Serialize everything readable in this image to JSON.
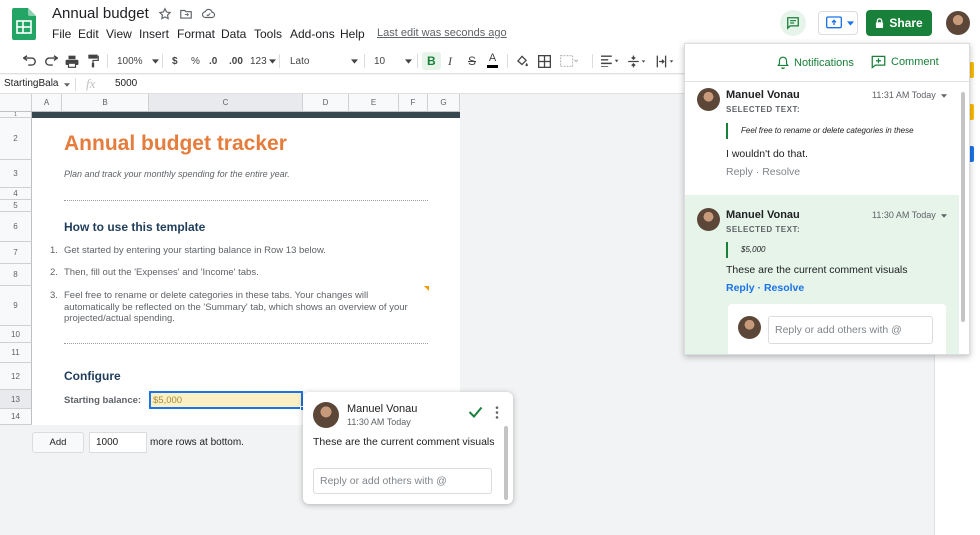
{
  "doc": {
    "title": "Annual budget",
    "last_edit": "Last edit was seconds ago"
  },
  "menu": [
    "File",
    "Edit",
    "View",
    "Insert",
    "Format",
    "Data",
    "Tools",
    "Add-ons",
    "Help"
  ],
  "share": {
    "label": "Share"
  },
  "toolbar": {
    "zoom": "100%",
    "currency": "$",
    "percent": "%",
    "dec_decrease": ".0",
    "dec_increase": ".00",
    "more_formats": "123",
    "font": "Lato",
    "font_size": "10"
  },
  "formula": {
    "name_box": "StartingBala",
    "fx": "fx",
    "value": "5000"
  },
  "columns": [
    "A",
    "B",
    "C",
    "D",
    "E",
    "F",
    "G"
  ],
  "rows": [
    "1",
    "2",
    "3",
    "4",
    "5",
    "6",
    "7",
    "8",
    "9",
    "10",
    "11",
    "12",
    "13",
    "14"
  ],
  "sheet": {
    "title": "Annual budget tracker",
    "subtitle": "Plan and track your monthly spending for the entire year.",
    "howto_heading": "How to use this template",
    "steps": [
      {
        "num": "1.",
        "text": "Get started by entering your starting balance in Row 13 below."
      },
      {
        "num": "2.",
        "text": "Then, fill out the 'Expenses' and 'Income' tabs."
      },
      {
        "num": "3.",
        "text": "Feel free to rename or delete categories in these tabs. Your changes will automatically be reflected on the 'Summary' tab, which shows an overview of your projected/actual spending."
      }
    ],
    "configure_heading": "Configure",
    "starting_balance_label": "Starting balance:",
    "starting_balance_value": "$5,000"
  },
  "add_rows": {
    "button": "Add",
    "count": "1000",
    "suffix": "more rows at bottom."
  },
  "panel": {
    "notifications": "Notifications",
    "comment": "Comment",
    "selected_text_label": "SELECTED TEXT:",
    "threads": [
      {
        "author": "Manuel Vonau",
        "time": "11:31 AM Today",
        "quote": "Feel free to rename or delete categories in these",
        "text": "I wouldn't do that.",
        "reply": "Reply",
        "resolve": "Resolve"
      },
      {
        "author": "Manuel Vonau",
        "time": "11:30 AM Today",
        "quote": "$5,000",
        "text": "These are the current comment visuals",
        "reply": "Reply",
        "resolve": "Resolve"
      }
    ],
    "reply_placeholder": "Reply or add others with @"
  },
  "popup": {
    "author": "Manuel Vonau",
    "time": "11:30 AM Today",
    "text": "These are the current comment visuals",
    "reply_placeholder": "Reply or add others with @"
  },
  "colors": {
    "accent_green": "#188038",
    "title_orange": "#e67c3b",
    "heading_blue": "#1f3c5a",
    "selected_fill": "#fdf0c2",
    "selected_border": "#1a73e8"
  }
}
